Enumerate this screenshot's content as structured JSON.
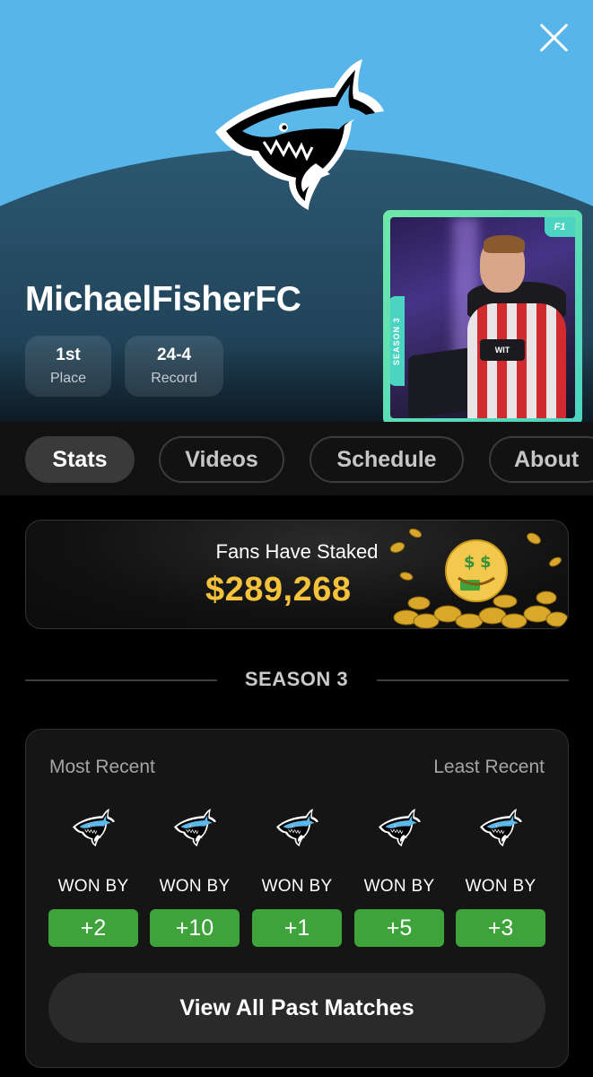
{
  "header": {
    "close_icon": "close-icon",
    "team_logo_icon": "shark-logo-icon"
  },
  "player": {
    "name": "MichaelFisherFC",
    "place_value": "1st",
    "place_label": "Place",
    "record_value": "24-4",
    "record_label": "Record"
  },
  "player_card": {
    "season_tag": "SEASON 3",
    "brand_tag": "F1",
    "sponsor_text": "WIT",
    "accent_color": "#4bd4c2"
  },
  "tabs": [
    {
      "label": "Stats",
      "active": true
    },
    {
      "label": "Videos",
      "active": false
    },
    {
      "label": "Schedule",
      "active": false
    },
    {
      "label": "About",
      "active": false
    }
  ],
  "stake": {
    "title": "Fans Have Staked",
    "amount": "$289,268",
    "amount_color": "#f5c23b",
    "emoji_icon": "money-mouth-face-icon"
  },
  "season": {
    "label": "SEASON 3"
  },
  "matches": {
    "most_recent_label": "Most Recent",
    "least_recent_label": "Least Recent",
    "items": [
      {
        "label": "WON BY",
        "margin": "+2",
        "opponent_icon": "shark-logo-icon"
      },
      {
        "label": "WON BY",
        "margin": "+10",
        "opponent_icon": "shark-logo-icon"
      },
      {
        "label": "WON BY",
        "margin": "+1",
        "opponent_icon": "shark-logo-icon"
      },
      {
        "label": "WON BY",
        "margin": "+5",
        "opponent_icon": "shark-logo-icon"
      },
      {
        "label": "WON BY",
        "margin": "+3",
        "opponent_icon": "shark-logo-icon"
      }
    ],
    "win_color": "#3da33a",
    "view_all_label": "View All Past Matches"
  },
  "colors": {
    "sky": "#57b5ea",
    "brand_blue": "#5bb8ea"
  }
}
